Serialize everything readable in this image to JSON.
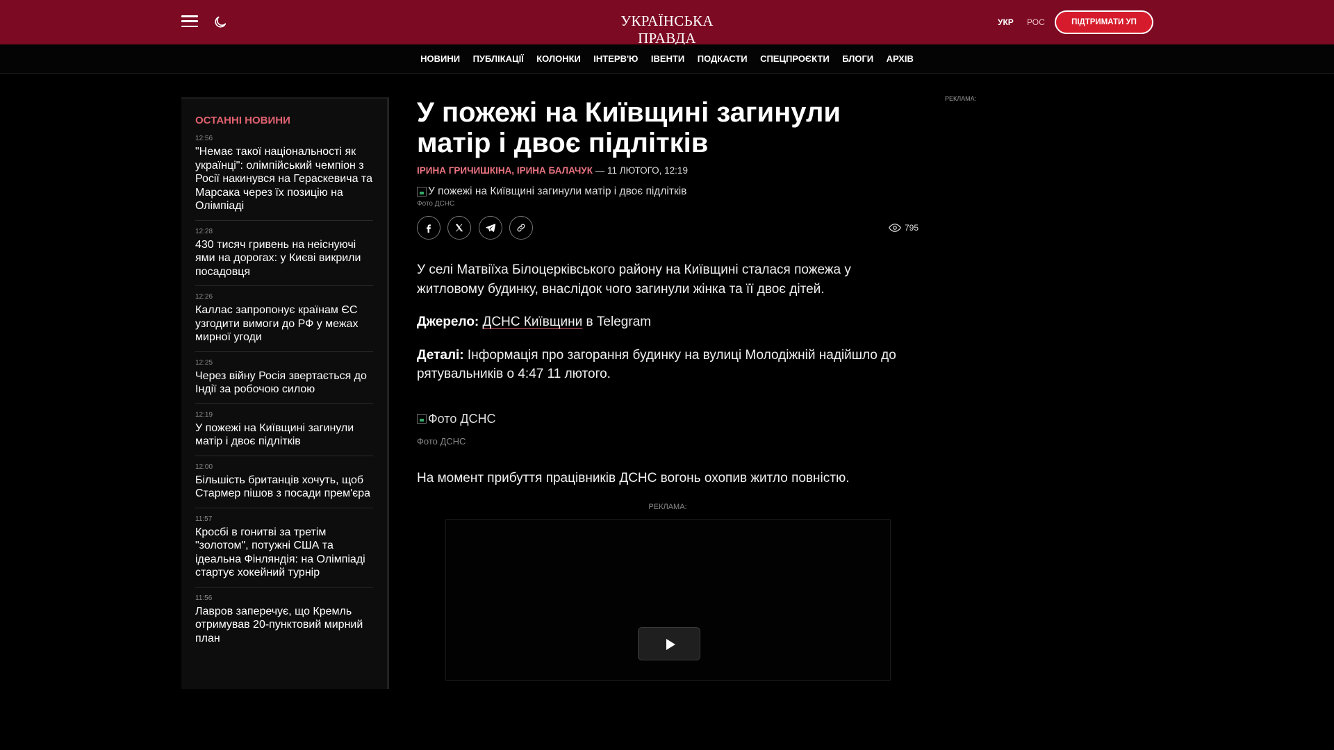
{
  "header": {
    "logo": "УКРАЇНСЬКА ПРАВДА",
    "lang_ukr": "УКР",
    "lang_ros": "РОС",
    "support_label": "ПІДТРИМАТИ УП",
    "icons": [
      "menu-icon",
      "moon-icon"
    ]
  },
  "nav": {
    "items": [
      "НОВИНИ",
      "ПУБЛІКАЦІЇ",
      "КОЛОНКИ",
      "ІНТЕРВ'Ю",
      "ІВЕНТИ",
      "ПОДКАСТИ",
      "СПЕЦПРОЄКТИ",
      "БЛОГИ",
      "АРХІВ"
    ]
  },
  "sidebar": {
    "title": "ОСТАННІ НОВИНИ",
    "items": [
      {
        "time": "12:56",
        "text": "\"Немає такої національності як українці\": олімпійський чемпіон з Росії накинувся на Гераскевича та Марсака через їх позицію на Олімпіаді"
      },
      {
        "time": "12:28",
        "text": "430 тисяч гривень на неіснуючі ями на дорогах: у Києві викрили посадовця"
      },
      {
        "time": "12:26",
        "text": "Каллас запропонує країнам ЄС узгодити вимоги до РФ у межах мирної угоди"
      },
      {
        "time": "12:25",
        "text": "Через війну Росія звертається до Індії за робочою силою"
      },
      {
        "time": "12:19",
        "text": "У пожежі на Київщині загинули матір і двоє підлітків"
      },
      {
        "time": "12:00",
        "text": "Більшість британців хочуть, щоб Стармер пішов з посади прем'єра"
      },
      {
        "time": "11:57",
        "text": "Кросбі в гонитві за третім \"золотом\", потужні США та ідеальна Фінляндія: на Олімпіаді стартує хокейний турнір"
      },
      {
        "time": "11:56",
        "text": "Лавров заперечує, що Кремль отримував 20-пунктовий мирний план"
      }
    ]
  },
  "article": {
    "headline": "У пожежі на Київщині загинули матір і двоє підлітків",
    "authors": "ІРИНА ГРИЧИШКІНА, ІРИНА БАЛАЧУК",
    "date": "— 11 ЛЮТОГО, 12:19",
    "hero_alt": "У пожежі на Київщині загинули матір і двоє підлітків",
    "hero_caption": "Фото ДСНС",
    "views": "795",
    "paragraph1": "У селі Матвіїха Білоцерківського району на Київщині сталася пожежа у житловому будинку, внаслідок чого загинули жінка та її двоє дітей.",
    "source_label": "Джерело:",
    "source_link": "ДСНС Київщини",
    "source_rest": " в Telegram",
    "details_label": "Деталі:",
    "details_text": " Інформація про загорання будинку на вулиці Молодіжній надійшло до рятувальників о 4:47 11 лютого.",
    "photo_alt": "Фото ДСНС",
    "photo_caption": "Фото ДСНС",
    "paragraph_after": "На момент прибуття працівників ДСНС вогонь охопив житло повністю.",
    "ad_label": "РЕКЛАМА:"
  },
  "right_ad_label": "РЕКЛАМА:",
  "colors": {
    "header_bg": "#7c0a23",
    "accent": "#e0626f",
    "support_btn": "#d61c2c"
  }
}
